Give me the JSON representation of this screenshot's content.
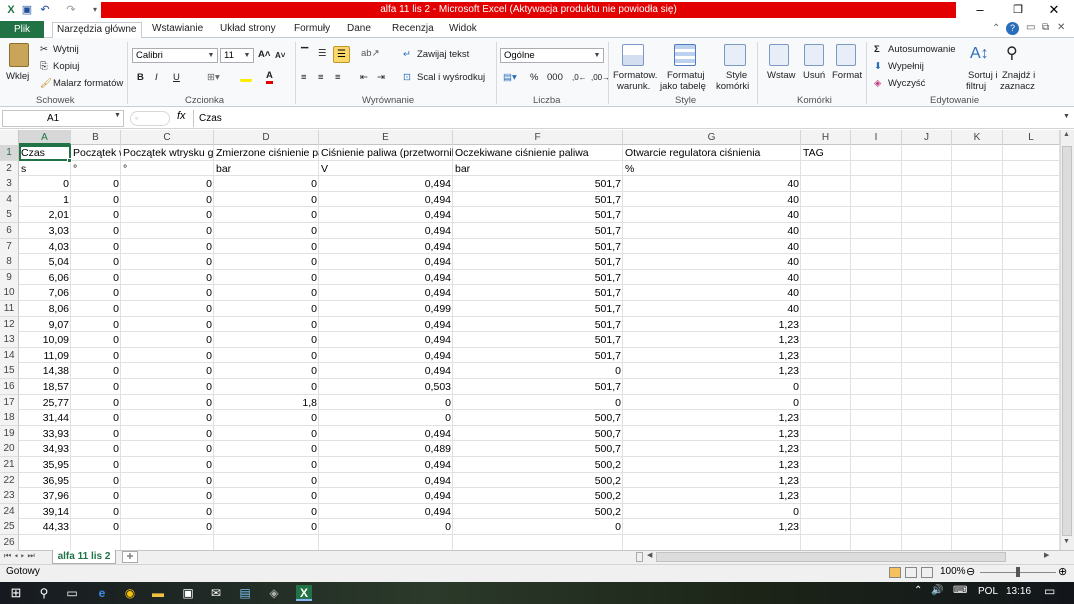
{
  "window": {
    "title": "alfa 11 lis 2  -  Microsoft Excel (Aktywacja produktu nie powiodła się)",
    "accent_color": "#217346",
    "title_highlight_color": "#e30000"
  },
  "ribbon_tabs": {
    "file": "Plik",
    "items": [
      "Narzędzia główne",
      "Wstawianie",
      "Układ strony",
      "Formuły",
      "Dane",
      "Recenzja",
      "Widok"
    ],
    "active": "Narzędzia główne"
  },
  "ribbon": {
    "clipboard": {
      "label": "Schowek",
      "paste": "Wklej",
      "cut": "Wytnij",
      "copy": "Kopiuj",
      "format_painter": "Malarz formatów"
    },
    "font": {
      "label": "Czcionka",
      "name": "Calibri",
      "size": "11",
      "bold": "B",
      "italic": "I",
      "underline": "U"
    },
    "alignment": {
      "label": "Wyrównanie",
      "wrap": "Zawijaj tekst",
      "merge": "Scal i wyśrodkuj"
    },
    "number": {
      "label": "Liczba",
      "format": "Ogólne",
      "percent": "%",
      "thousands": "000"
    },
    "styles": {
      "label": "Style",
      "conditional_l1": "Formatow.",
      "conditional_l2": "warunk.",
      "table_l1": "Formatuj",
      "table_l2": "jako tabelę",
      "cell_l1": "Style",
      "cell_l2": "komórki"
    },
    "cells": {
      "label": "Komórki",
      "insert": "Wstaw",
      "delete": "Usuń",
      "format": "Format"
    },
    "editing": {
      "label": "Edytowanie",
      "autosum": "Autosumowanie",
      "fill": "Wypełnij",
      "clear": "Wyczyść",
      "sort_l1": "Sortuj i",
      "sort_l2": "filtruj",
      "find_l1": "Znajdź i",
      "find_l2": "zaznacz"
    }
  },
  "formula_bar": {
    "name_box": "A1",
    "fx": "fx",
    "value": "Czas"
  },
  "columns": [
    "A",
    "B",
    "C",
    "D",
    "E",
    "F",
    "G",
    "H",
    "I",
    "J",
    "K",
    "L"
  ],
  "header_row": [
    "Czas",
    "Początek wtrysku",
    "Początek wtrysku g",
    "Zmierzone ciśnienie paliwa",
    "Ciśnienie paliwa (przetwornik)",
    "Oczekiwane ciśnienie paliwa",
    "Otwarcie regulatora ciśnienia",
    "TAG"
  ],
  "unit_row": [
    "s",
    "°",
    "°",
    "bar",
    "V",
    "bar",
    "%",
    ""
  ],
  "rows": [
    [
      "0",
      "0",
      "0",
      "0",
      "0,494",
      "501,7",
      "40"
    ],
    [
      "1",
      "0",
      "0",
      "0",
      "0,494",
      "501,7",
      "40"
    ],
    [
      "2,01",
      "0",
      "0",
      "0",
      "0,494",
      "501,7",
      "40"
    ],
    [
      "3,03",
      "0",
      "0",
      "0",
      "0,494",
      "501,7",
      "40"
    ],
    [
      "4,03",
      "0",
      "0",
      "0",
      "0,494",
      "501,7",
      "40"
    ],
    [
      "5,04",
      "0",
      "0",
      "0",
      "0,494",
      "501,7",
      "40"
    ],
    [
      "6,06",
      "0",
      "0",
      "0",
      "0,494",
      "501,7",
      "40"
    ],
    [
      "7,06",
      "0",
      "0",
      "0",
      "0,494",
      "501,7",
      "40"
    ],
    [
      "8,06",
      "0",
      "0",
      "0",
      "0,499",
      "501,7",
      "40"
    ],
    [
      "9,07",
      "0",
      "0",
      "0",
      "0,494",
      "501,7",
      "1,23"
    ],
    [
      "10,09",
      "0",
      "0",
      "0",
      "0,494",
      "501,7",
      "1,23"
    ],
    [
      "11,09",
      "0",
      "0",
      "0",
      "0,494",
      "501,7",
      "1,23"
    ],
    [
      "14,38",
      "0",
      "0",
      "0",
      "0,494",
      "0",
      "1,23"
    ],
    [
      "18,57",
      "0",
      "0",
      "0",
      "0,503",
      "501,7",
      "0"
    ],
    [
      "25,77",
      "0",
      "0",
      "1,8",
      "0",
      "0",
      "0"
    ],
    [
      "31,44",
      "0",
      "0",
      "0",
      "0",
      "500,7",
      "1,23"
    ],
    [
      "33,93",
      "0",
      "0",
      "0",
      "0,494",
      "500,7",
      "1,23"
    ],
    [
      "34,93",
      "0",
      "0",
      "0",
      "0,489",
      "500,7",
      "1,23"
    ],
    [
      "35,95",
      "0",
      "0",
      "0",
      "0,494",
      "500,2",
      "1,23"
    ],
    [
      "36,95",
      "0",
      "0",
      "0",
      "0,494",
      "500,2",
      "1,23"
    ],
    [
      "37,96",
      "0",
      "0",
      "0",
      "0,494",
      "500,2",
      "1,23"
    ],
    [
      "39,14",
      "0",
      "0",
      "0",
      "0,494",
      "500,2",
      "0"
    ],
    [
      "44,33",
      "0",
      "0",
      "0",
      "0",
      "0",
      "1,23"
    ]
  ],
  "row_numbers": [
    "1",
    "2",
    "3",
    "4",
    "5",
    "6",
    "7",
    "8",
    "9",
    "10",
    "11",
    "12",
    "13",
    "14",
    "15",
    "16",
    "17",
    "18",
    "19",
    "20",
    "21",
    "22",
    "23",
    "24",
    "25",
    "26"
  ],
  "sheet_tab": "alfa 11 lis 2",
  "status": {
    "ready": "Gotowy",
    "zoom": "100%"
  },
  "taskbar": {
    "language": "POL",
    "time": "13:16"
  }
}
